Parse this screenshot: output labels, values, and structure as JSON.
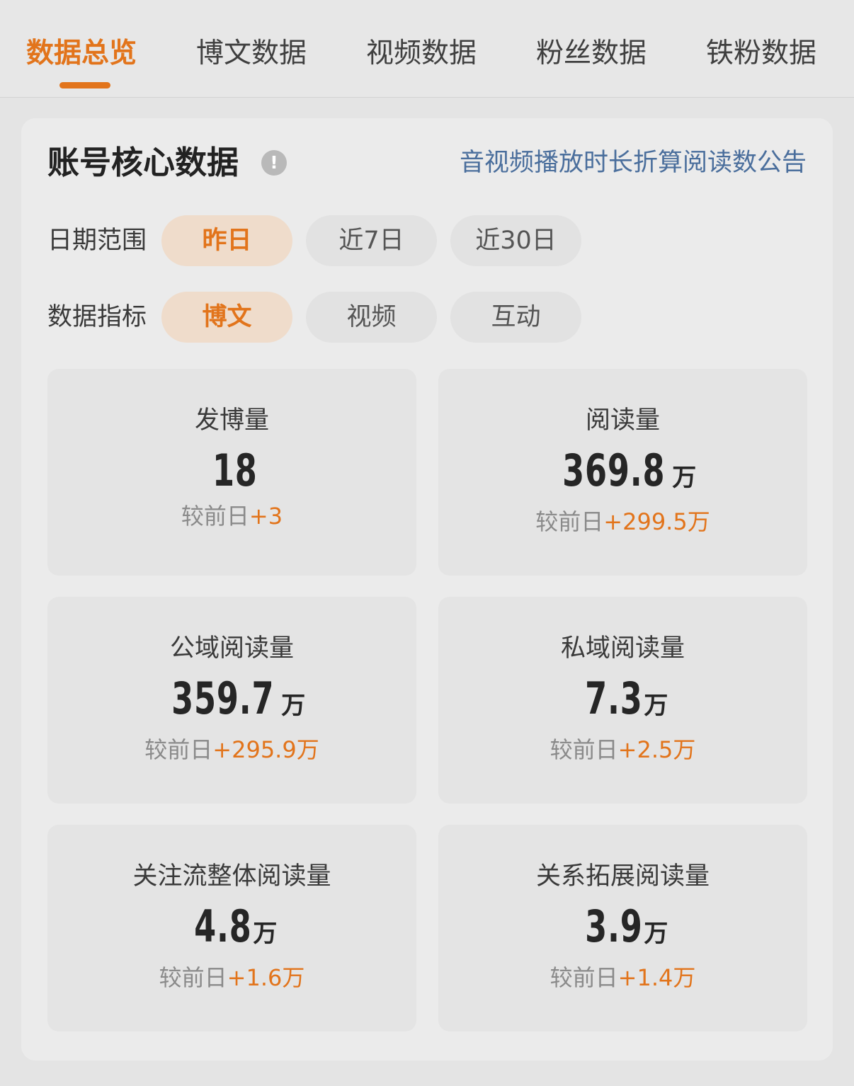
{
  "tabs": [
    {
      "label": "数据总览",
      "active": true
    },
    {
      "label": "博文数据",
      "active": false
    },
    {
      "label": "视频数据",
      "active": false
    },
    {
      "label": "粉丝数据",
      "active": false
    },
    {
      "label": "铁粉数据",
      "active": false
    }
  ],
  "core": {
    "title": "账号核心数据",
    "info_icon": "!",
    "notice_link": "音视频播放时长折算阅读数公告"
  },
  "date_range": {
    "label": "日期范围",
    "options": [
      "昨日",
      "近7日",
      "近30日"
    ],
    "selected": "昨日"
  },
  "metric_type": {
    "label": "数据指标",
    "options": [
      "博文",
      "视频",
      "互动"
    ],
    "selected": "博文"
  },
  "compare_prefix": "较前日",
  "metrics": [
    {
      "label": "发博量",
      "value": "18",
      "unit": "",
      "delta": "+3"
    },
    {
      "label": "阅读量",
      "value": "369.8",
      "unit": "万",
      "delta": "+299.5万"
    },
    {
      "label": "公域阅读量",
      "value": "359.7",
      "unit": "万",
      "delta": "+295.9万"
    },
    {
      "label": "私域阅读量",
      "value": "7.3",
      "unit": "万",
      "delta": "+2.5万"
    },
    {
      "label": "关注流整体阅读量",
      "value": "4.8",
      "unit": "万",
      "delta": "+1.6万"
    },
    {
      "label": "关系拓展阅读量",
      "value": "3.9",
      "unit": "万",
      "delta": "+1.4万"
    }
  ],
  "colors": {
    "accent": "#e2741b",
    "link": "#4a6e9c",
    "active_pill_bg": "#efdccb"
  }
}
